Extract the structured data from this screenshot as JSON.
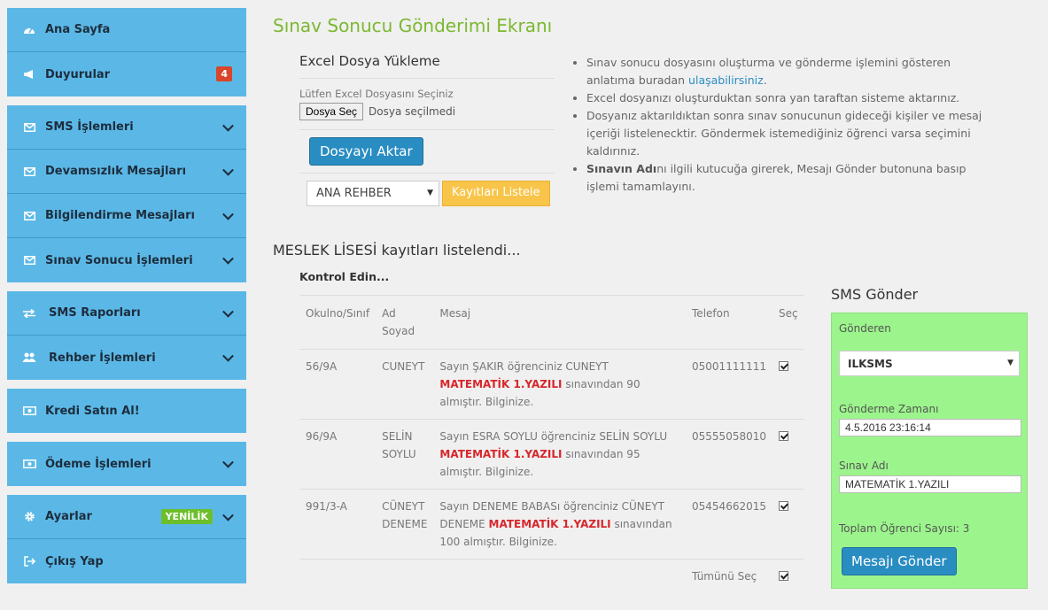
{
  "sidebar": {
    "items": [
      {
        "label": "Ana Sayfa",
        "icon": "dashboard-icon"
      },
      {
        "label": "Duyurular",
        "icon": "megaphone-icon",
        "badge": "4"
      },
      {
        "label": "SMS İşlemleri",
        "icon": "envelope-icon"
      },
      {
        "label": "Devamsızlık Mesajları",
        "icon": "envelope-icon"
      },
      {
        "label": "Bilgilendirme Mesajları",
        "icon": "envelope-icon"
      },
      {
        "label": "Sınav Sonucu İşlemleri",
        "icon": "envelope-icon"
      },
      {
        "label": "SMS Raporları",
        "icon": "exchange-icon"
      },
      {
        "label": "Rehber İşlemleri",
        "icon": "users-icon"
      },
      {
        "label": "Kredi Satın Al!",
        "icon": "money-icon"
      },
      {
        "label": "Ödeme İşlemleri",
        "icon": "money-icon"
      },
      {
        "label": "Ayarlar",
        "icon": "gear-icon",
        "badge": "YENİLİK"
      },
      {
        "label": "Çıkış Yap",
        "icon": "sign-out-icon"
      }
    ]
  },
  "page": {
    "title": "Sınav Sonucu Gönderimi Ekranı"
  },
  "upload": {
    "heading": "Excel Dosya Yükleme",
    "file_label": "Lütfen Excel Dosyasını Seçiniz",
    "file_button": "Dosya Seç",
    "file_status": "Dosya seçilmedi",
    "import_button": "Dosyayı Aktar",
    "group_select_value": "ANA REHBER",
    "list_button": "Kayıtları Listele"
  },
  "info": {
    "item1_text": "Sınav sonucu dosyasını oluşturma ve gönderme işlemini gösteren anlatıma buradan ",
    "item1_link": "ulaşabilirsiniz",
    "item1_end": ".",
    "item2": "Excel dosyanızı oluşturduktan sonra yan taraftan sisteme aktarınız.",
    "item3": "Dosyanız aktarıldıktan sonra sınav sonucunun gideceği kişiler ve mesaj içeriği listelenecktir. Göndermek istemediğiniz öğrenci varsa seçimini kaldırınız.",
    "item4_bold": "Sınavın Adı",
    "item4_text": "nı ilgili kutucuğa girerek, Mesajı Gönder butonuna basıp işlemi tamamlayını."
  },
  "results": {
    "title": "MESLEK LİSESİ kayıtları listelendi...",
    "subtitle": "Kontrol Edin...",
    "columns": [
      "Okulno/Sınıf",
      "Ad Soyad",
      "Mesaj",
      "Telefon",
      "Seç"
    ],
    "rows": [
      {
        "okulno": "56/9A",
        "ad": "CUNEYT",
        "msg_pre": "Sayın ŞAKIR öğrenciniz CUNEYT ",
        "msg_red": "MATEMATİK 1.YAZILI",
        "msg_post": " sınavından 90 almıştır. Bilginize.",
        "phone": "05001111111",
        "checked": true
      },
      {
        "okulno": "96/9A",
        "ad": "SELİN SOYLU",
        "msg_pre": "Sayın ESRA SOYLU öğrenciniz SELİN SOYLU ",
        "msg_red": "MATEMATİK 1.YAZILI",
        "msg_post": " sınavından 95 almıştır. Bilginize.",
        "phone": "05555058010",
        "checked": true
      },
      {
        "okulno": "991/3-A",
        "ad": "CÜNEYT DENEME",
        "msg_pre": "Sayın DENEME BABASı öğrenciniz CÜNEYT DENEME ",
        "msg_red": "MATEMATİK 1.YAZILI",
        "msg_post": " sınavından 100 almıştır. Bilginize.",
        "phone": "05454662015",
        "checked": true
      }
    ],
    "select_all_label": "Tümünü Seç"
  },
  "sms": {
    "title": "SMS Gönder",
    "sender_label": "Gönderen",
    "sender_value": "ILKSMS",
    "time_label": "Gönderme Zamanı",
    "time_value": "4.5.2016 23:16:14",
    "exam_label": "Sınav Adı",
    "exam_value": "MATEMATİK 1.YAZILI",
    "total_label": "Toplam Öğrenci Sayısı: 3",
    "send_button": "Mesajı Gönder"
  },
  "colors": {
    "sidebar": "#5bb8e6",
    "title": "#7cb82f",
    "primary": "#2a8dc2",
    "warning": "#f8c54a",
    "sms_panel": "#9cf58c",
    "highlight": "#d8262b"
  }
}
